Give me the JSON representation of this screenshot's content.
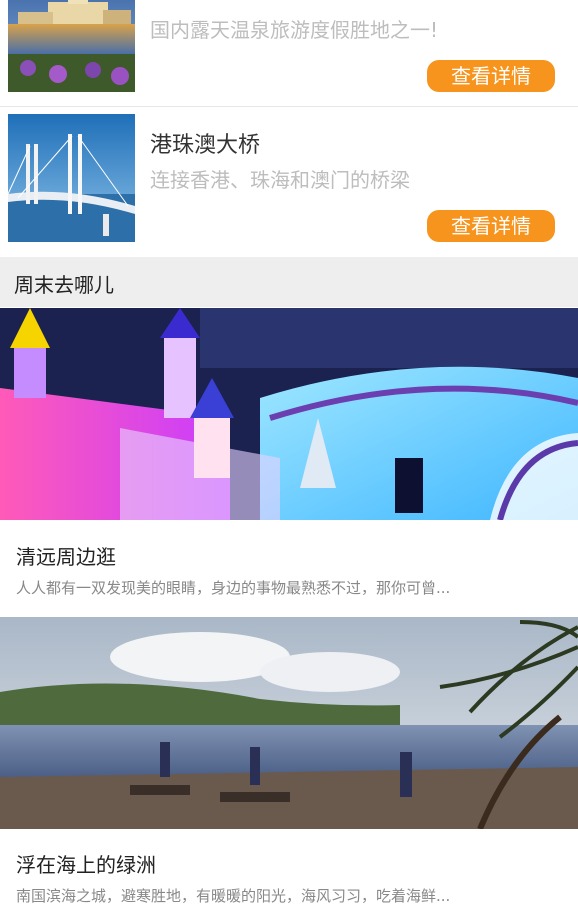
{
  "list": [
    {
      "title": "",
      "desc": "国内露天温泉旅游度假胜地之一!",
      "button": "查看详情"
    },
    {
      "title": "港珠澳大桥",
      "desc": "连接香港、珠海和澳门的桥梁",
      "button": "查看详情"
    }
  ],
  "section": {
    "title": "周末去哪儿"
  },
  "posts": [
    {
      "title": "清远周边逛",
      "desc": "人人都有一双发现美的眼睛，身边的事物最熟悉不过，那你可曾..."
    },
    {
      "title": "浮在海上的绿洲",
      "desc": "南国滨海之城，避寒胜地，有暖暖的阳光，海风习习，吃着海鲜..."
    }
  ],
  "colors": {
    "accent": "#f7941d",
    "section_bg": "#eeeeee"
  }
}
